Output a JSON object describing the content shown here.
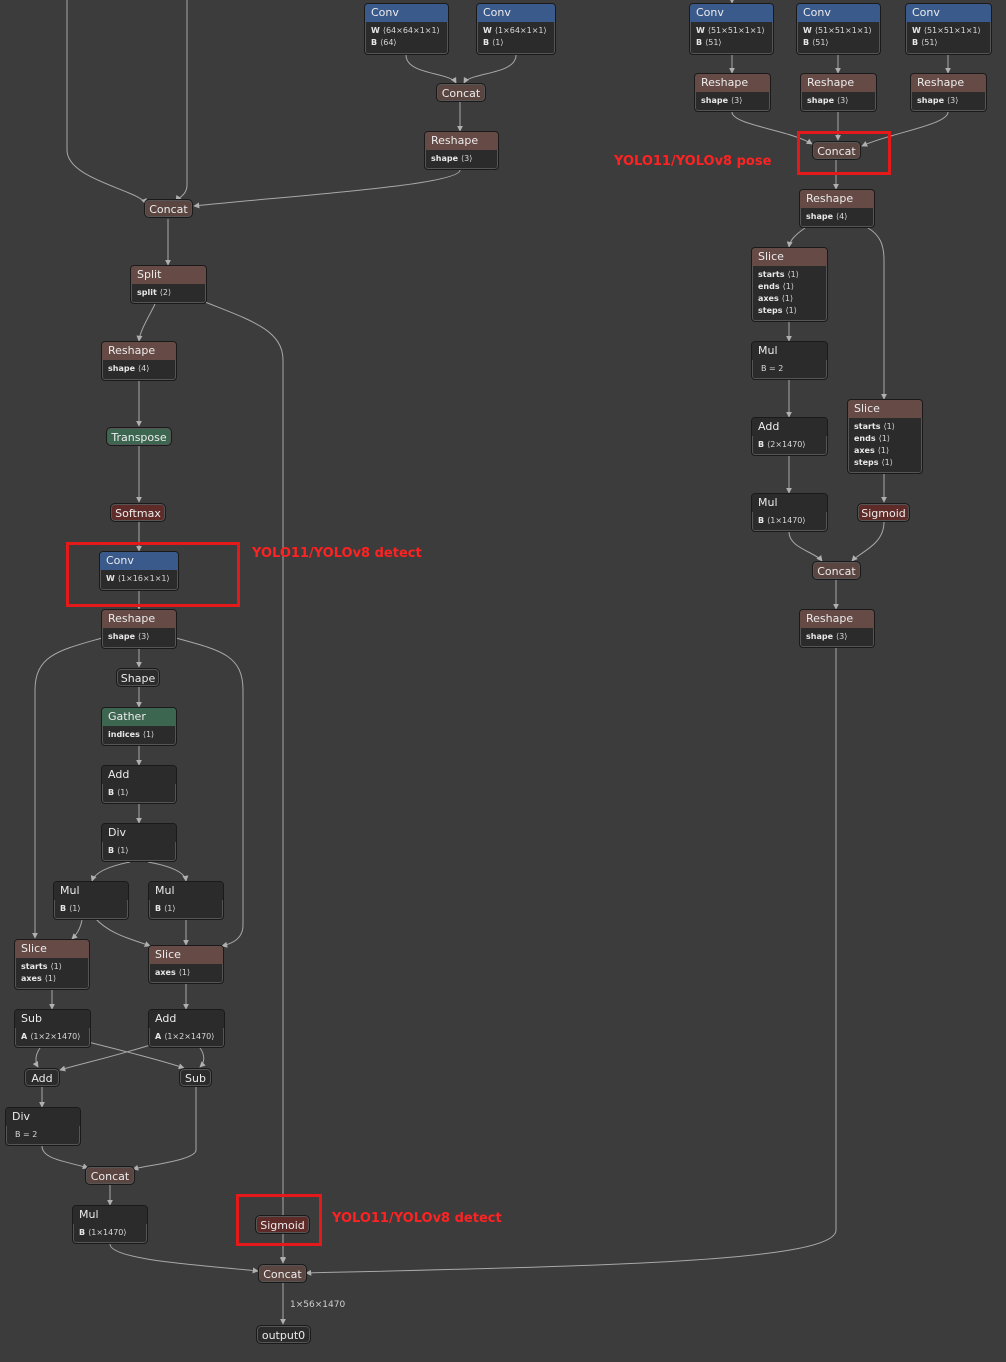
{
  "annotations": {
    "pose": "YOLO11/YOLOv8 pose",
    "detect_conv": "YOLO11/YOLOv8 detect",
    "detect_sigmoid": "YOLO11/YOLOv8 detect"
  },
  "edge_label": "1×56×1470",
  "colors": {
    "highlight": "#e41919",
    "conv": "#3a5a8c",
    "reshape": "#654a45",
    "activation": "#5e2b28",
    "transpose_gather": "#3d6650",
    "edge": "#a8a8a8"
  },
  "nodes": {
    "conv64": {
      "title": "Conv",
      "attrs": [
        {
          "k": "W",
          "v": "⟨64×64×1×1⟩"
        },
        {
          "k": "B",
          "v": "⟨64⟩"
        }
      ]
    },
    "conv1": {
      "title": "Conv",
      "attrs": [
        {
          "k": "W",
          "v": "⟨1×64×1×1⟩"
        },
        {
          "k": "B",
          "v": "⟨1⟩"
        }
      ]
    },
    "concat_top": {
      "title": "Concat"
    },
    "reshape_top": {
      "title": "Reshape",
      "attrs": [
        {
          "k": "shape",
          "v": "⟨3⟩"
        }
      ]
    },
    "concat_main": {
      "title": "Concat"
    },
    "split": {
      "title": "Split",
      "attrs": [
        {
          "k": "split",
          "v": "⟨2⟩"
        }
      ]
    },
    "reshape_a": {
      "title": "Reshape",
      "attrs": [
        {
          "k": "shape",
          "v": "⟨4⟩"
        }
      ]
    },
    "transpose": {
      "title": "Transpose"
    },
    "softmax": {
      "title": "Softmax"
    },
    "conv_detect": {
      "title": "Conv",
      "attrs": [
        {
          "k": "W",
          "v": "⟨1×16×1×1⟩"
        }
      ]
    },
    "reshape_b": {
      "title": "Reshape",
      "attrs": [
        {
          "k": "shape",
          "v": "⟨3⟩"
        }
      ]
    },
    "shape": {
      "title": "Shape"
    },
    "gather": {
      "title": "Gather",
      "attrs": [
        {
          "k": "indices",
          "v": "⟨1⟩"
        }
      ]
    },
    "add_1": {
      "title": "Add",
      "attrs": [
        {
          "k": "B",
          "v": "⟨1⟩"
        }
      ]
    },
    "div_1": {
      "title": "Div",
      "attrs": [
        {
          "k": "B",
          "v": "⟨1⟩"
        }
      ]
    },
    "mul_a": {
      "title": "Mul",
      "attrs": [
        {
          "k": "B",
          "v": "⟨1⟩"
        }
      ]
    },
    "mul_b": {
      "title": "Mul",
      "attrs": [
        {
          "k": "B",
          "v": "⟨1⟩"
        }
      ]
    },
    "slice_left": {
      "title": "Slice",
      "attrs": [
        {
          "k": "starts",
          "v": "⟨1⟩"
        },
        {
          "k": "axes",
          "v": "⟨1⟩"
        }
      ]
    },
    "slice_right": {
      "title": "Slice",
      "attrs": [
        {
          "k": "axes",
          "v": "⟨1⟩"
        }
      ]
    },
    "sub_a": {
      "title": "Sub",
      "attrs": [
        {
          "k": "A",
          "v": "⟨1×2×1470⟩"
        }
      ]
    },
    "add_a": {
      "title": "Add",
      "attrs": [
        {
          "k": "A",
          "v": "⟨1×2×1470⟩"
        }
      ]
    },
    "add_small": {
      "title": "Add"
    },
    "sub_small": {
      "title": "Sub"
    },
    "div_2": {
      "title": "Div",
      "attrs": [
        {
          "k": "",
          "v": "B = 2"
        }
      ]
    },
    "concat_bl": {
      "title": "Concat"
    },
    "mul_bl": {
      "title": "Mul",
      "attrs": [
        {
          "k": "B",
          "v": "⟨1×1470⟩"
        }
      ]
    },
    "sigmoid_main": {
      "title": "Sigmoid"
    },
    "concat_final": {
      "title": "Concat"
    },
    "output0": {
      "title": "output0"
    },
    "pconv1": {
      "title": "Conv",
      "attrs": [
        {
          "k": "W",
          "v": "⟨51×51×1×1⟩"
        },
        {
          "k": "B",
          "v": "⟨51⟩"
        }
      ]
    },
    "pconv2": {
      "title": "Conv",
      "attrs": [
        {
          "k": "W",
          "v": "⟨51×51×1×1⟩"
        },
        {
          "k": "B",
          "v": "⟨51⟩"
        }
      ]
    },
    "pconv3": {
      "title": "Conv",
      "attrs": [
        {
          "k": "W",
          "v": "⟨51×51×1×1⟩"
        },
        {
          "k": "B",
          "v": "⟨51⟩"
        }
      ]
    },
    "preshape1": {
      "title": "Reshape",
      "attrs": [
        {
          "k": "shape",
          "v": "⟨3⟩"
        }
      ]
    },
    "preshape2": {
      "title": "Reshape",
      "attrs": [
        {
          "k": "shape",
          "v": "⟨3⟩"
        }
      ]
    },
    "preshape3": {
      "title": "Reshape",
      "attrs": [
        {
          "k": "shape",
          "v": "⟨3⟩"
        }
      ]
    },
    "pconcat": {
      "title": "Concat"
    },
    "preshape4": {
      "title": "Reshape",
      "attrs": [
        {
          "k": "shape",
          "v": "⟨4⟩"
        }
      ]
    },
    "pslice1": {
      "title": "Slice",
      "attrs": [
        {
          "k": "starts",
          "v": "⟨1⟩"
        },
        {
          "k": "ends",
          "v": "⟨1⟩"
        },
        {
          "k": "axes",
          "v": "⟨1⟩"
        },
        {
          "k": "steps",
          "v": "⟨1⟩"
        }
      ]
    },
    "pmul1": {
      "title": "Mul",
      "attrs": [
        {
          "k": "",
          "v": "B = 2"
        }
      ]
    },
    "padd": {
      "title": "Add",
      "attrs": [
        {
          "k": "B",
          "v": "⟨2×1470⟩"
        }
      ]
    },
    "pmul2": {
      "title": "Mul",
      "attrs": [
        {
          "k": "B",
          "v": "⟨1×1470⟩"
        }
      ]
    },
    "pslice2": {
      "title": "Slice",
      "attrs": [
        {
          "k": "starts",
          "v": "⟨1⟩"
        },
        {
          "k": "ends",
          "v": "⟨1⟩"
        },
        {
          "k": "axes",
          "v": "⟨1⟩"
        },
        {
          "k": "steps",
          "v": "⟨1⟩"
        }
      ]
    },
    "psigmoid": {
      "title": "Sigmoid"
    },
    "pconcat2": {
      "title": "Concat"
    },
    "preshape5": {
      "title": "Reshape",
      "attrs": [
        {
          "k": "shape",
          "v": "⟨3⟩"
        }
      ]
    }
  }
}
